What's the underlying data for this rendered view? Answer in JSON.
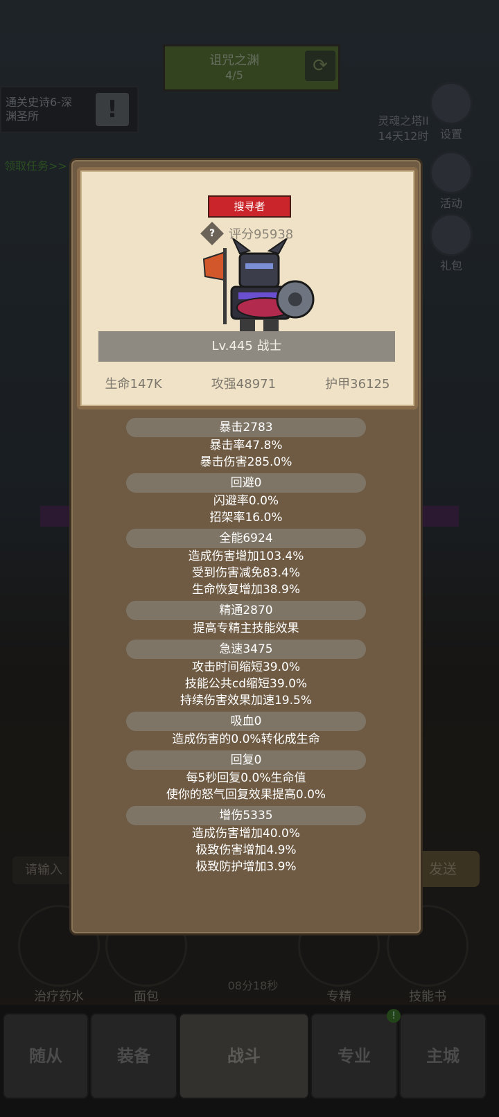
{
  "background": {
    "dungeon": {
      "name": "诅咒之渊",
      "progress": "4/5"
    },
    "quest": {
      "text": "通关史诗6-深渊圣所",
      "claim_label": "领取任务>>"
    },
    "soul_tower": {
      "name": "灵魂之塔II",
      "time": "14天12时"
    },
    "side_menu": [
      {
        "icon": "gear-icon",
        "label": "设置"
      },
      {
        "icon": "scroll-icon",
        "label": "活动"
      },
      {
        "icon": "gift-icon",
        "label": "礼包"
      }
    ],
    "chat_placeholder": "请输入",
    "send_label": "发送",
    "abilities": [
      {
        "icon": "potion-icon",
        "label": "治疗药水"
      },
      {
        "icon": "bread-icon",
        "label": "面包"
      },
      {
        "icon": "specialty-icon",
        "label": "专精"
      },
      {
        "icon": "skill-book-icon",
        "label": "技能书"
      }
    ],
    "timer": "08分18秒",
    "nav_tabs": [
      "随从",
      "装备",
      "战斗",
      "专业",
      "主城"
    ],
    "nav_badge": "!"
  },
  "character": {
    "role_badge": "搜寻者",
    "score": "评分95938",
    "level_class": "Lv.445 战士",
    "hp": "生命147K",
    "attack": "攻强48971",
    "armor": "护甲36125"
  },
  "attributes": [
    {
      "head": "暴击2783",
      "lines": [
        "暴击率47.8%",
        "暴击伤害285.0%"
      ]
    },
    {
      "head": "回避0",
      "lines": [
        "闪避率0.0%",
        "招架率16.0%"
      ]
    },
    {
      "head": "全能6924",
      "lines": [
        "造成伤害增加103.4%",
        "受到伤害减免83.4%",
        "生命恢复增加38.9%"
      ]
    },
    {
      "head": "精通2870",
      "lines": [
        "提高专精主技能效果"
      ]
    },
    {
      "head": "急速3475",
      "lines": [
        "攻击时间缩短39.0%",
        "技能公共cd缩短39.0%",
        "持续伤害效果加速19.5%"
      ]
    },
    {
      "head": "吸血0",
      "lines": [
        "造成伤害的0.0%转化成生命"
      ]
    },
    {
      "head": "回复0",
      "lines": [
        "每5秒回复0.0%生命值",
        "使你的怒气回复效果提高0.0%"
      ]
    },
    {
      "head": "增伤5335",
      "lines": [
        "造成伤害增加40.0%",
        "极致伤害增加4.9%",
        "极致防护增加3.9%"
      ]
    }
  ],
  "colors": {
    "badge_red": "#c9252a",
    "panel_brown": "#6f5b43",
    "card_parchment": "#efe2c6"
  }
}
